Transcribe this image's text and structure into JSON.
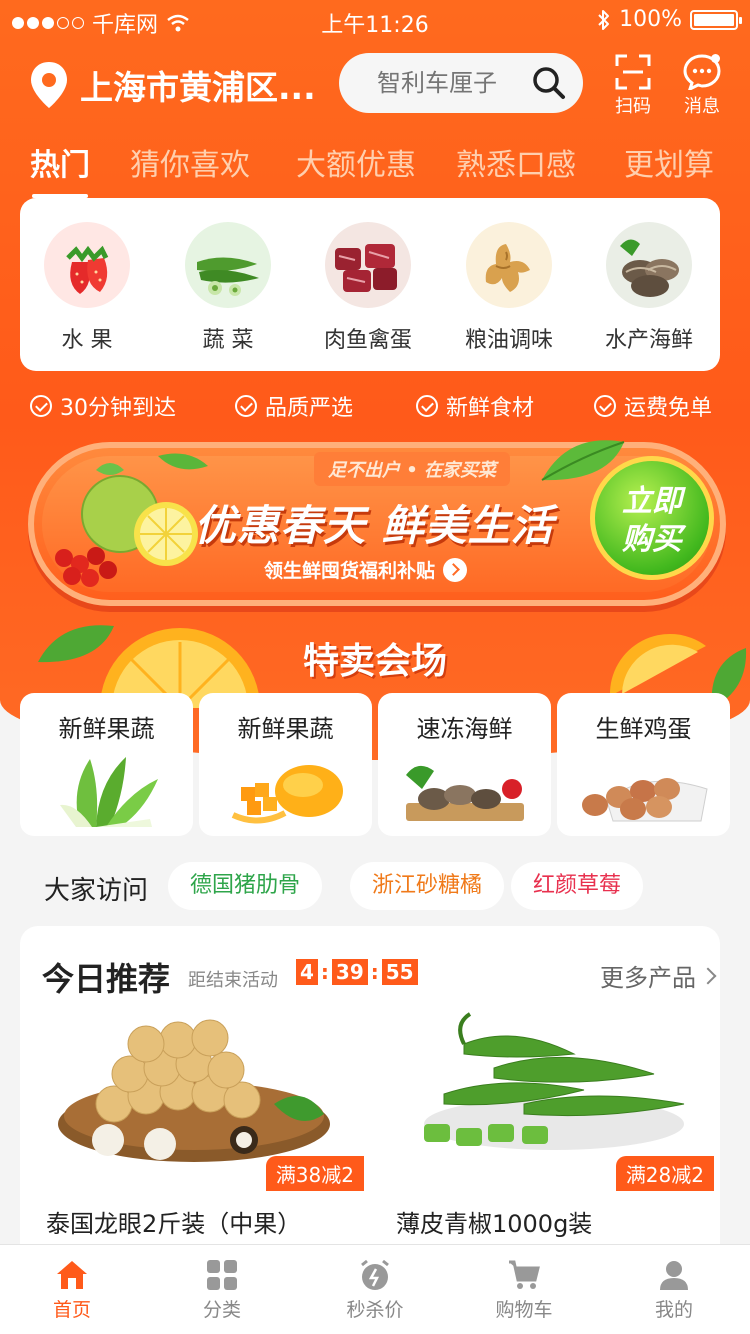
{
  "status_bar": {
    "carrier": "千库网",
    "time": "上午11:26",
    "battery": "100%",
    "battery_level": 1.0
  },
  "header": {
    "location": "上海市黄浦区...",
    "search_placeholder": "智利车厘子",
    "scan_label": "扫码",
    "message_label": "消息"
  },
  "tabs": [
    {
      "label": "热门",
      "active": true
    },
    {
      "label": "猜你喜欢",
      "active": false
    },
    {
      "label": "大额优惠",
      "active": false
    },
    {
      "label": "熟悉口感",
      "active": false
    },
    {
      "label": "更划算",
      "active": false
    }
  ],
  "categories": [
    {
      "label": "水 果",
      "icon": "strawberry-icon"
    },
    {
      "label": "蔬 菜",
      "icon": "okra-icon"
    },
    {
      "label": "肉鱼禽蛋",
      "icon": "meat-icon"
    },
    {
      "label": "粮油调味",
      "icon": "ginger-icon"
    },
    {
      "label": "水产海鲜",
      "icon": "clam-icon"
    }
  ],
  "features": [
    "30分钟到达",
    "品质严选",
    "新鲜食材",
    "运费免单"
  ],
  "banner": {
    "tag": "足不出户 • 在家买菜",
    "title": "优惠春天 鲜美生活",
    "subtitle": "领生鲜囤货福利补贴",
    "buy_line1": "立即",
    "buy_line2": "购买"
  },
  "special": {
    "title": "特卖会场",
    "items": [
      {
        "label": "新鲜果蔬",
        "icon": "bok-choy-icon"
      },
      {
        "label": "新鲜果蔬",
        "icon": "mango-icon"
      },
      {
        "label": "速冻海鲜",
        "icon": "seafood-icon"
      },
      {
        "label": "生鲜鸡蛋",
        "icon": "eggs-icon"
      }
    ]
  },
  "visits": {
    "label": "大家访问",
    "chips": [
      {
        "label": "德国猪肋骨",
        "color": "#2ea54a"
      },
      {
        "label": "浙江砂糖橘",
        "color": "#f07a1a"
      },
      {
        "label": "红颜草莓",
        "color": "#e8304e"
      }
    ]
  },
  "recommend": {
    "title": "今日推荐",
    "ends_label": "距结束活动",
    "timer": {
      "h": "4",
      "m": "39",
      "s": "55"
    },
    "more": "更多产品",
    "products": [
      {
        "name": "泰国龙眼2斤装（中果）",
        "promo": "满38减2",
        "icon": "longan-icon"
      },
      {
        "name": "薄皮青椒1000g装",
        "promo": "满28减2",
        "icon": "green-pepper-icon"
      }
    ]
  },
  "tabbar": [
    {
      "label": "首页",
      "icon": "home-icon",
      "active": true
    },
    {
      "label": "分类",
      "icon": "grid-icon",
      "active": false
    },
    {
      "label": "秒杀价",
      "icon": "alarm-icon",
      "active": false
    },
    {
      "label": "购物车",
      "icon": "cart-icon",
      "active": false
    },
    {
      "label": "我的",
      "icon": "user-icon",
      "active": false
    }
  ],
  "colors": {
    "accent": "#ff5a1a",
    "header_bg": "#ff6a1e",
    "green": "#42b81e"
  }
}
